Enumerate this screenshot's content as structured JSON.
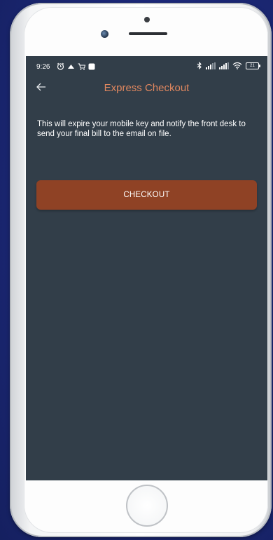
{
  "status_bar": {
    "time": "9:26",
    "left_icons": [
      "alarm-icon",
      "cloud-icon",
      "cart-icon",
      "square-notification-icon"
    ],
    "right_icons": [
      "bluetooth-icon",
      "signal-icon",
      "signal-icon",
      "wifi-icon",
      "battery-icon"
    ],
    "battery_level": "21"
  },
  "app_bar": {
    "back_icon": "arrow-left-icon",
    "title": "Express Checkout"
  },
  "content": {
    "message": "This will expire your mobile key and notify the front desk to send your final bill to the email on file.",
    "checkout_label": "CHECKOUT"
  },
  "colors": {
    "background": "#1b2774",
    "screen": "#323e49",
    "title_accent": "#e0875f",
    "button": "#8f4225",
    "text": "#ffffff"
  }
}
